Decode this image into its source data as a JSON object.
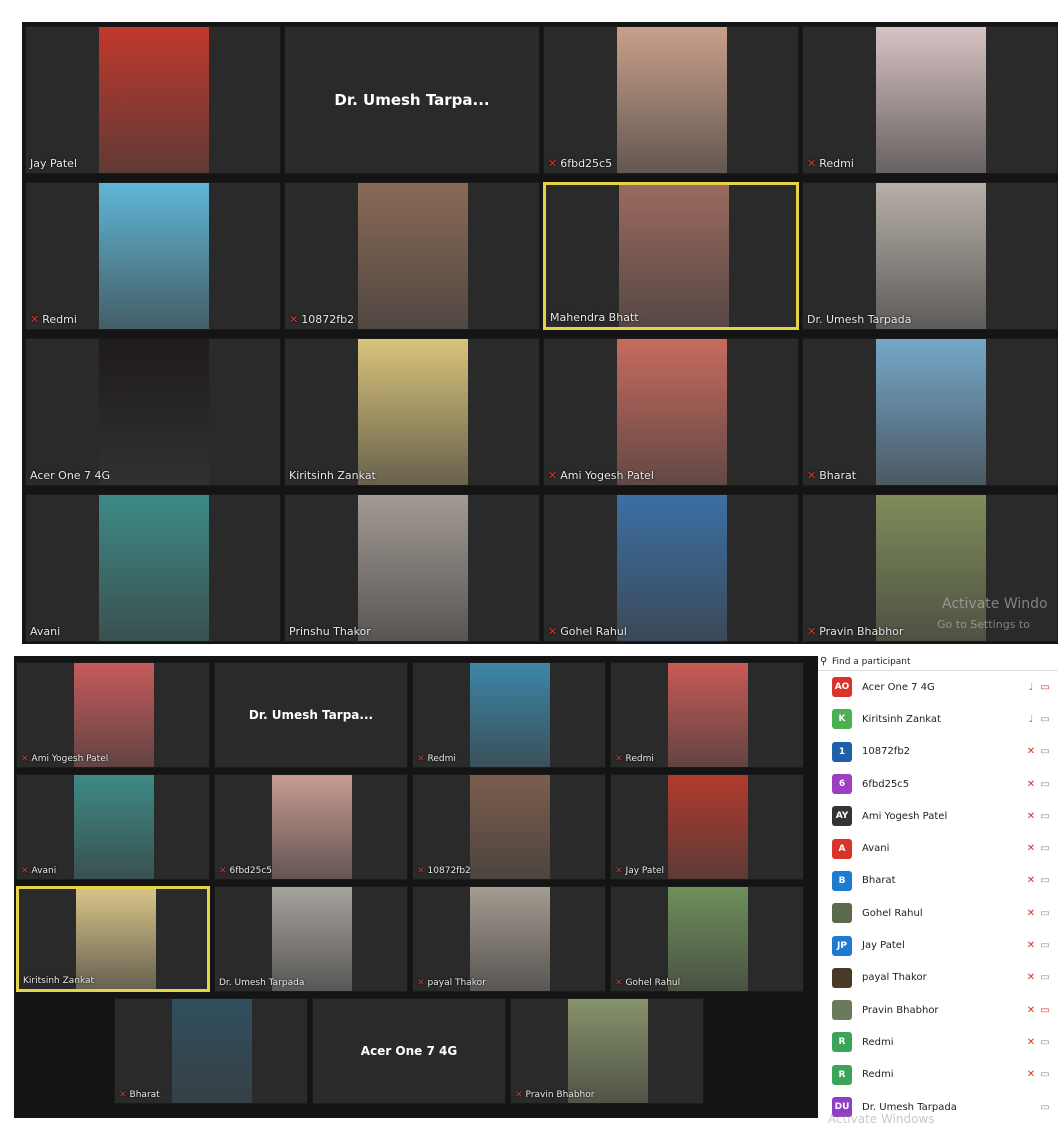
{
  "top_gallery": {
    "tiles": [
      {
        "name": "Jay Patel",
        "muted": false,
        "photo": "#c0392b"
      },
      {
        "name": "Dr. Umesh Tarpa...",
        "muted": false,
        "photo": null,
        "big": true
      },
      {
        "name": "6fbd25c5",
        "muted": true,
        "photo": "#c9a08a"
      },
      {
        "name": "Redmi",
        "muted": true,
        "photo": "#d8c3c3"
      },
      {
        "name": "Redmi",
        "muted": true,
        "photo": "#5fb6d6"
      },
      {
        "name": "10872fb2",
        "muted": true,
        "photo": "#8a6a57"
      },
      {
        "name": "Mahendra Bhatt",
        "muted": false,
        "photo": "#9b6a5e",
        "active": true
      },
      {
        "name": "Dr. Umesh Tarpada",
        "muted": false,
        "photo": "#b7b0a8"
      },
      {
        "name": "Acer One 7 4G",
        "muted": false,
        "photo": "#1e1b1a"
      },
      {
        "name": "Kiritsinh Zankat",
        "muted": false,
        "photo": "#d9c47a"
      },
      {
        "name": "Ami Yogesh Patel",
        "muted": true,
        "photo": "#c76b5e"
      },
      {
        "name": "Bharat",
        "muted": true,
        "photo": "#74a8c9"
      },
      {
        "name": "Avani",
        "muted": false,
        "photo": "#3c8a86"
      },
      {
        "name": "Prinshu Thakor",
        "muted": false,
        "photo": "#a29a94"
      },
      {
        "name": "Gohel Rahul",
        "muted": true,
        "photo": "#3c6fa3"
      },
      {
        "name": "Pravin Bhabhor",
        "muted": true,
        "photo": "#7f8c5a"
      }
    ]
  },
  "bottom_gallery": {
    "tiles": [
      {
        "name": "Ami Yogesh Patel",
        "muted": true,
        "photo": "#c65a5a"
      },
      {
        "name": "Dr. Umesh Tarpa...",
        "muted": false,
        "photo": null,
        "big": true
      },
      {
        "name": "Redmi",
        "muted": true,
        "photo": "#3d86a8"
      },
      {
        "name": "Redmi",
        "muted": true,
        "photo": "#c85a55"
      },
      {
        "name": "Avani",
        "muted": true,
        "photo": "#3c8a86"
      },
      {
        "name": "6fbd25c5",
        "muted": true,
        "photo": "#c89b91"
      },
      {
        "name": "10872fb2",
        "muted": true,
        "photo": "#7b5d4d"
      },
      {
        "name": "Jay Patel",
        "muted": true,
        "photo": "#b33a2d"
      },
      {
        "name": "Kiritsinh Zankat",
        "muted": false,
        "photo": "#d7c488",
        "active": true
      },
      {
        "name": "Dr. Umesh Tarpada",
        "muted": false,
        "photo": "#a6a29c"
      },
      {
        "name": "payal Thakor",
        "muted": true,
        "photo": "#a49a90"
      },
      {
        "name": "Gohel Rahul",
        "muted": true,
        "photo": "#6f8f5a"
      },
      {
        "name": "Bharat",
        "muted": true,
        "photo": "#2f4f5f"
      },
      {
        "name": "Acer One 7 4G",
        "muted": false,
        "photo": null,
        "big": true
      },
      {
        "name": "Pravin Bhabhor",
        "muted": true,
        "photo": "#87936a"
      }
    ]
  },
  "participants": {
    "search_placeholder": "Find a participant",
    "items": [
      {
        "initials": "AO",
        "name": "Acer One 7 4G",
        "color": "#d9342b",
        "mic": "unmuted",
        "video": "off"
      },
      {
        "initials": "K",
        "name": "Kiritsinh Zankat",
        "color": "#4caf50",
        "mic": "unmuted",
        "video": "on"
      },
      {
        "initials": "1",
        "name": "10872fb2",
        "color": "#1f5fa8",
        "mic": "muted",
        "video": "on"
      },
      {
        "initials": "6",
        "name": "6fbd25c5",
        "color": "#9c3fc4",
        "mic": "muted",
        "video": "on"
      },
      {
        "initials": "AY",
        "name": "Ami Yogesh Patel",
        "color": "#333333",
        "mic": "muted",
        "video": "on"
      },
      {
        "initials": "A",
        "name": "Avani",
        "color": "#d9342b",
        "mic": "muted",
        "video": "on"
      },
      {
        "initials": "B",
        "name": "Bharat",
        "color": "#1f7ad1",
        "mic": "muted",
        "video": "on"
      },
      {
        "initials": "",
        "name": "Gohel Rahul",
        "color": "#5a6a4a",
        "mic": "muted",
        "video": "on"
      },
      {
        "initials": "JP",
        "name": "Jay Patel",
        "color": "#1f7ad1",
        "mic": "muted",
        "video": "on"
      },
      {
        "initials": "",
        "name": "payal Thakor",
        "color": "#4a3a2a",
        "mic": "muted",
        "video": "on"
      },
      {
        "initials": "",
        "name": "Pravin Bhabhor",
        "color": "#6a7a5a",
        "mic": "muted",
        "video": "off"
      },
      {
        "initials": "R",
        "name": "Redmi",
        "color": "#3aa55a",
        "mic": "muted",
        "video": "on"
      },
      {
        "initials": "R",
        "name": "Redmi",
        "color": "#3aa55a",
        "mic": "muted",
        "video": "on"
      },
      {
        "initials": "DU",
        "name": "Dr. Umesh Tarpada",
        "color": "#8e3fc4",
        "mic": "none",
        "video": "on"
      }
    ]
  },
  "watermarks": {
    "activate_top": "Activate Windo",
    "settings_top": "Go to Settings to",
    "activate_bottom": "Activate Windows"
  },
  "icons": {
    "mic_muted": "mic-muted-icon",
    "mic": "mic-icon",
    "video": "video-icon",
    "search": "search-icon"
  }
}
